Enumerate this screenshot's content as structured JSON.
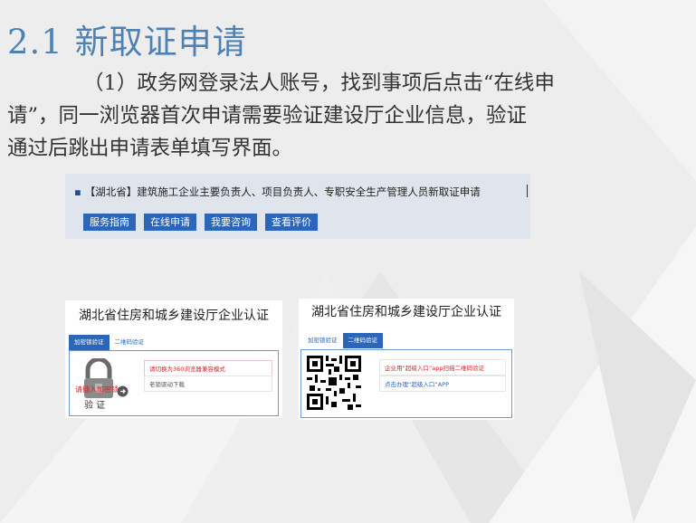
{
  "slide": {
    "title": "2.1 新取证申请",
    "paragraph_line1": "（1）政务网登录法人账号，找到事项后点击“在线申",
    "paragraph_line2": "请”，同一浏览器首次申请需要验证建设厅企业信息，验证",
    "paragraph_line3": "通过后跳出申请表单填写界面。"
  },
  "banner": {
    "title": "【湖北省】建筑施工企业主要负责人、项目负责人、专职安全生产管理人员新取证申请",
    "buttons": [
      "服务指南",
      "在线申请",
      "我要咨询",
      "查看评价"
    ]
  },
  "auth_left": {
    "title": "湖北省住房和城乡建设厅企业认证",
    "tabs": [
      "加密锁验证",
      "二维码验证"
    ],
    "active_tab": 0,
    "insert_prompt": "请插入加密锁",
    "verify_text": "验 证",
    "links": [
      "请切换为360浏览器兼容模式",
      "老锁驱动下载"
    ]
  },
  "auth_right": {
    "title": "湖北省住房和城乡建设厅企业认证",
    "tabs": [
      "加密锁验证",
      "二维码验证"
    ],
    "active_tab": 1,
    "links": [
      "企业用“超级入口”app扫描二维码验证",
      "点击办理“超级入口”APP"
    ]
  },
  "colors": {
    "title_blue": "#4d82b4",
    "button_blue": "#2b66b8",
    "link_red": "#d0262b"
  }
}
